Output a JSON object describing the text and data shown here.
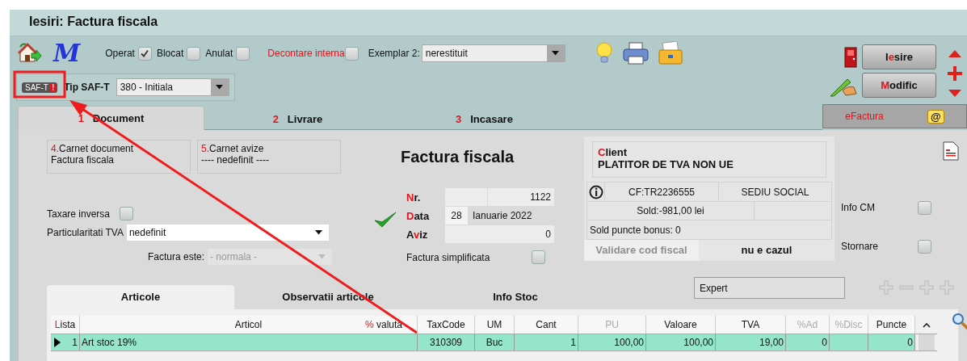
{
  "window": {
    "title": "Iesiri: Factura fiscala"
  },
  "logo": "M",
  "options": [
    {
      "label": "Operat",
      "checked": true,
      "accent": false
    },
    {
      "label": "Blocat",
      "checked": false,
      "accent": false
    },
    {
      "label": "Anulat",
      "checked": false,
      "accent": false
    },
    {
      "label": "Decontare interna",
      "checked": false,
      "accent": true
    }
  ],
  "exemplar_2": {
    "label": "Exemplar 2:",
    "value": "nerestituit"
  },
  "buttons": [
    {
      "kind": "exit",
      "label": [
        {
          "text": "I",
          "accent": false
        },
        {
          "text": "e",
          "accent": true
        },
        {
          "text": "sire",
          "accent": false
        }
      ]
    },
    {
      "kind": "edit",
      "label": [
        {
          "text": "M",
          "accent": true
        },
        {
          "text": "odific",
          "accent": false
        }
      ]
    }
  ],
  "saft": {
    "badge": "SAF-T",
    "badge_mark": "!",
    "label": "Tip SAF-T",
    "value": "380 - Initiala"
  },
  "tabs": [
    {
      "number": "1",
      "label": "Document",
      "selected": true
    },
    {
      "number": "2",
      "label": "Livrare",
      "selected": false
    },
    {
      "number": "3",
      "label": "Incasare",
      "selected": false
    }
  ],
  "efactura": {
    "label": "eFactura",
    "icon_glyph": "@"
  },
  "carnets": [
    {
      "number": "4.",
      "label": "Carnet document",
      "value": "Factura fiscala"
    },
    {
      "number": "5.",
      "label": "Carnet avize",
      "value": "---- nedefinit ----"
    }
  ],
  "document_title": "Factura fiscala",
  "taxare_inversa": {
    "label": "Taxare inversa",
    "checked": false
  },
  "particularitati_tva": {
    "label": "Particularitati TVA",
    "value": "nedefinit"
  },
  "factura_este": {
    "label": "Factura este:",
    "value": "- normala -",
    "disabled": true
  },
  "document_fields": [
    {
      "kind": "number",
      "label": [
        {
          "text": "N",
          "accent": true
        },
        {
          "text": "r.",
          "accent": false
        }
      ],
      "value": "1122"
    },
    {
      "kind": "date",
      "label": [
        {
          "text": "D",
          "accent": true
        },
        {
          "text": "ata",
          "accent": false
        }
      ],
      "day": "28",
      "value": "Ianuarie 2022"
    },
    {
      "kind": "plain",
      "label": [
        {
          "text": "A",
          "accent": false
        },
        {
          "text": "v",
          "accent": true
        },
        {
          "text": "iz",
          "accent": false
        }
      ],
      "value": "0"
    }
  ],
  "factura_simplificata": {
    "label": "Factura simplificata",
    "checked": false
  },
  "client": {
    "label": [
      {
        "text": "C",
        "accent": true
      },
      {
        "text": "lient",
        "accent": false
      }
    ],
    "name": "PLATITOR DE TVA NON UE",
    "cf": "CF:TR2236555",
    "address": "SEDIU SOCIAL",
    "sold": "Sold:-981,00 lei",
    "bonus": "Sold puncte bonus:  0",
    "validate_button": {
      "label": "Validare cod fiscal",
      "disabled": true
    },
    "status": "nu e cazul"
  },
  "side_options": [
    {
      "label": "Info CM",
      "checked": false
    },
    {
      "label": "Stornare",
      "checked": false
    }
  ],
  "sub_tabs": [
    {
      "label": "Articole",
      "selected": true
    },
    {
      "label": "Observatii articole",
      "selected": false
    },
    {
      "label": "Info Stoc",
      "selected": false
    }
  ],
  "expert_field": {
    "value": "Expert"
  },
  "table": {
    "columns": [
      {
        "label": [
          {
            "text": "L",
            "accent": true
          },
          {
            "text": "ista",
            "accent": false
          }
        ],
        "disabled": false
      },
      {
        "label": [
          {
            "text": "Articol",
            "accent": false
          }
        ],
        "extra": [
          {
            "text": "%",
            "accent": true
          },
          {
            "text": " valuta",
            "accent": false
          }
        ],
        "disabled": false
      },
      {
        "label": [
          {
            "text": "TaxCode",
            "accent": false
          }
        ],
        "disabled": false
      },
      {
        "label": [
          {
            "text": "UM",
            "accent": false
          }
        ],
        "disabled": false
      },
      {
        "label": [
          {
            "text": "Cant",
            "accent": false
          }
        ],
        "disabled": false
      },
      {
        "label": [
          {
            "text": "PU",
            "accent": false
          }
        ],
        "disabled": true
      },
      {
        "label": [
          {
            "text": "Valoare",
            "accent": false
          }
        ],
        "disabled": false
      },
      {
        "label": [
          {
            "text": "TVA",
            "accent": false
          }
        ],
        "disabled": false
      },
      {
        "label": [
          {
            "text": "%Ad",
            "accent": false
          }
        ],
        "disabled": true
      },
      {
        "label": [
          {
            "text": "%Disc",
            "accent": false
          }
        ],
        "disabled": true
      },
      {
        "label": [
          {
            "text": "Puncte",
            "accent": false
          }
        ],
        "disabled": false
      }
    ],
    "rows": [
      {
        "selected": true,
        "cells": [
          "1",
          "Art stoc 19%",
          "310309",
          "Buc",
          "1",
          "100,00",
          "100,00",
          "19,00",
          "0",
          null,
          "0"
        ]
      }
    ]
  },
  "annotation": {
    "highlight_frame": true,
    "arrow": true
  }
}
